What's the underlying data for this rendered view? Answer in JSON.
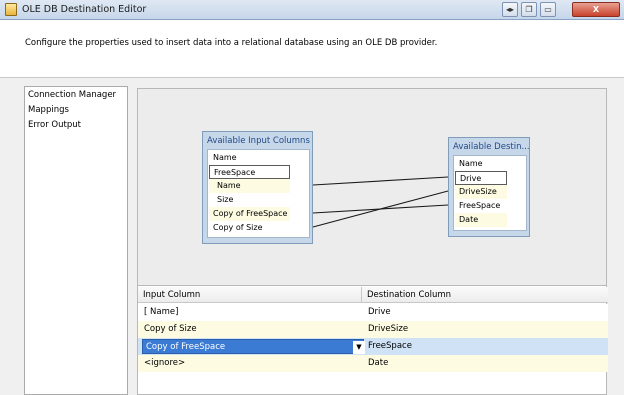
{
  "window": {
    "title": "OLE DB Destination Editor",
    "help_glyph": "◂▸",
    "restore_glyph": "❐",
    "maximize_glyph": "▭",
    "close_glyph": "X"
  },
  "header": {
    "description": "Configure the properties used to insert data into a relational database using an OLE DB provider."
  },
  "nav": {
    "items": [
      {
        "label": "Connection Manager"
      },
      {
        "label": "Mappings"
      },
      {
        "label": "Error Output"
      }
    ]
  },
  "diagram": {
    "input_box": {
      "title": "Available Input Columns",
      "header": "Name",
      "columns": [
        "FreeSpace",
        "Name",
        "Size",
        "Copy of FreeSpace",
        "Copy of  Size"
      ]
    },
    "destination_box": {
      "title": "Available Destin...",
      "header": "Name",
      "columns": [
        "Drive",
        "DriveSize",
        "FreeSpace",
        "Date"
      ]
    }
  },
  "grid": {
    "headers": {
      "input": "Input Column",
      "destination": "Destination Column"
    },
    "rows": [
      {
        "input": "[ Name]",
        "destination": "Drive"
      },
      {
        "input": "Copy of  Size",
        "destination": "DriveSize"
      },
      {
        "input": "Copy of FreeSpace",
        "destination": "FreeSpace"
      },
      {
        "input": "<ignore>",
        "destination": "Date"
      }
    ],
    "combo_arrow": "▼"
  }
}
